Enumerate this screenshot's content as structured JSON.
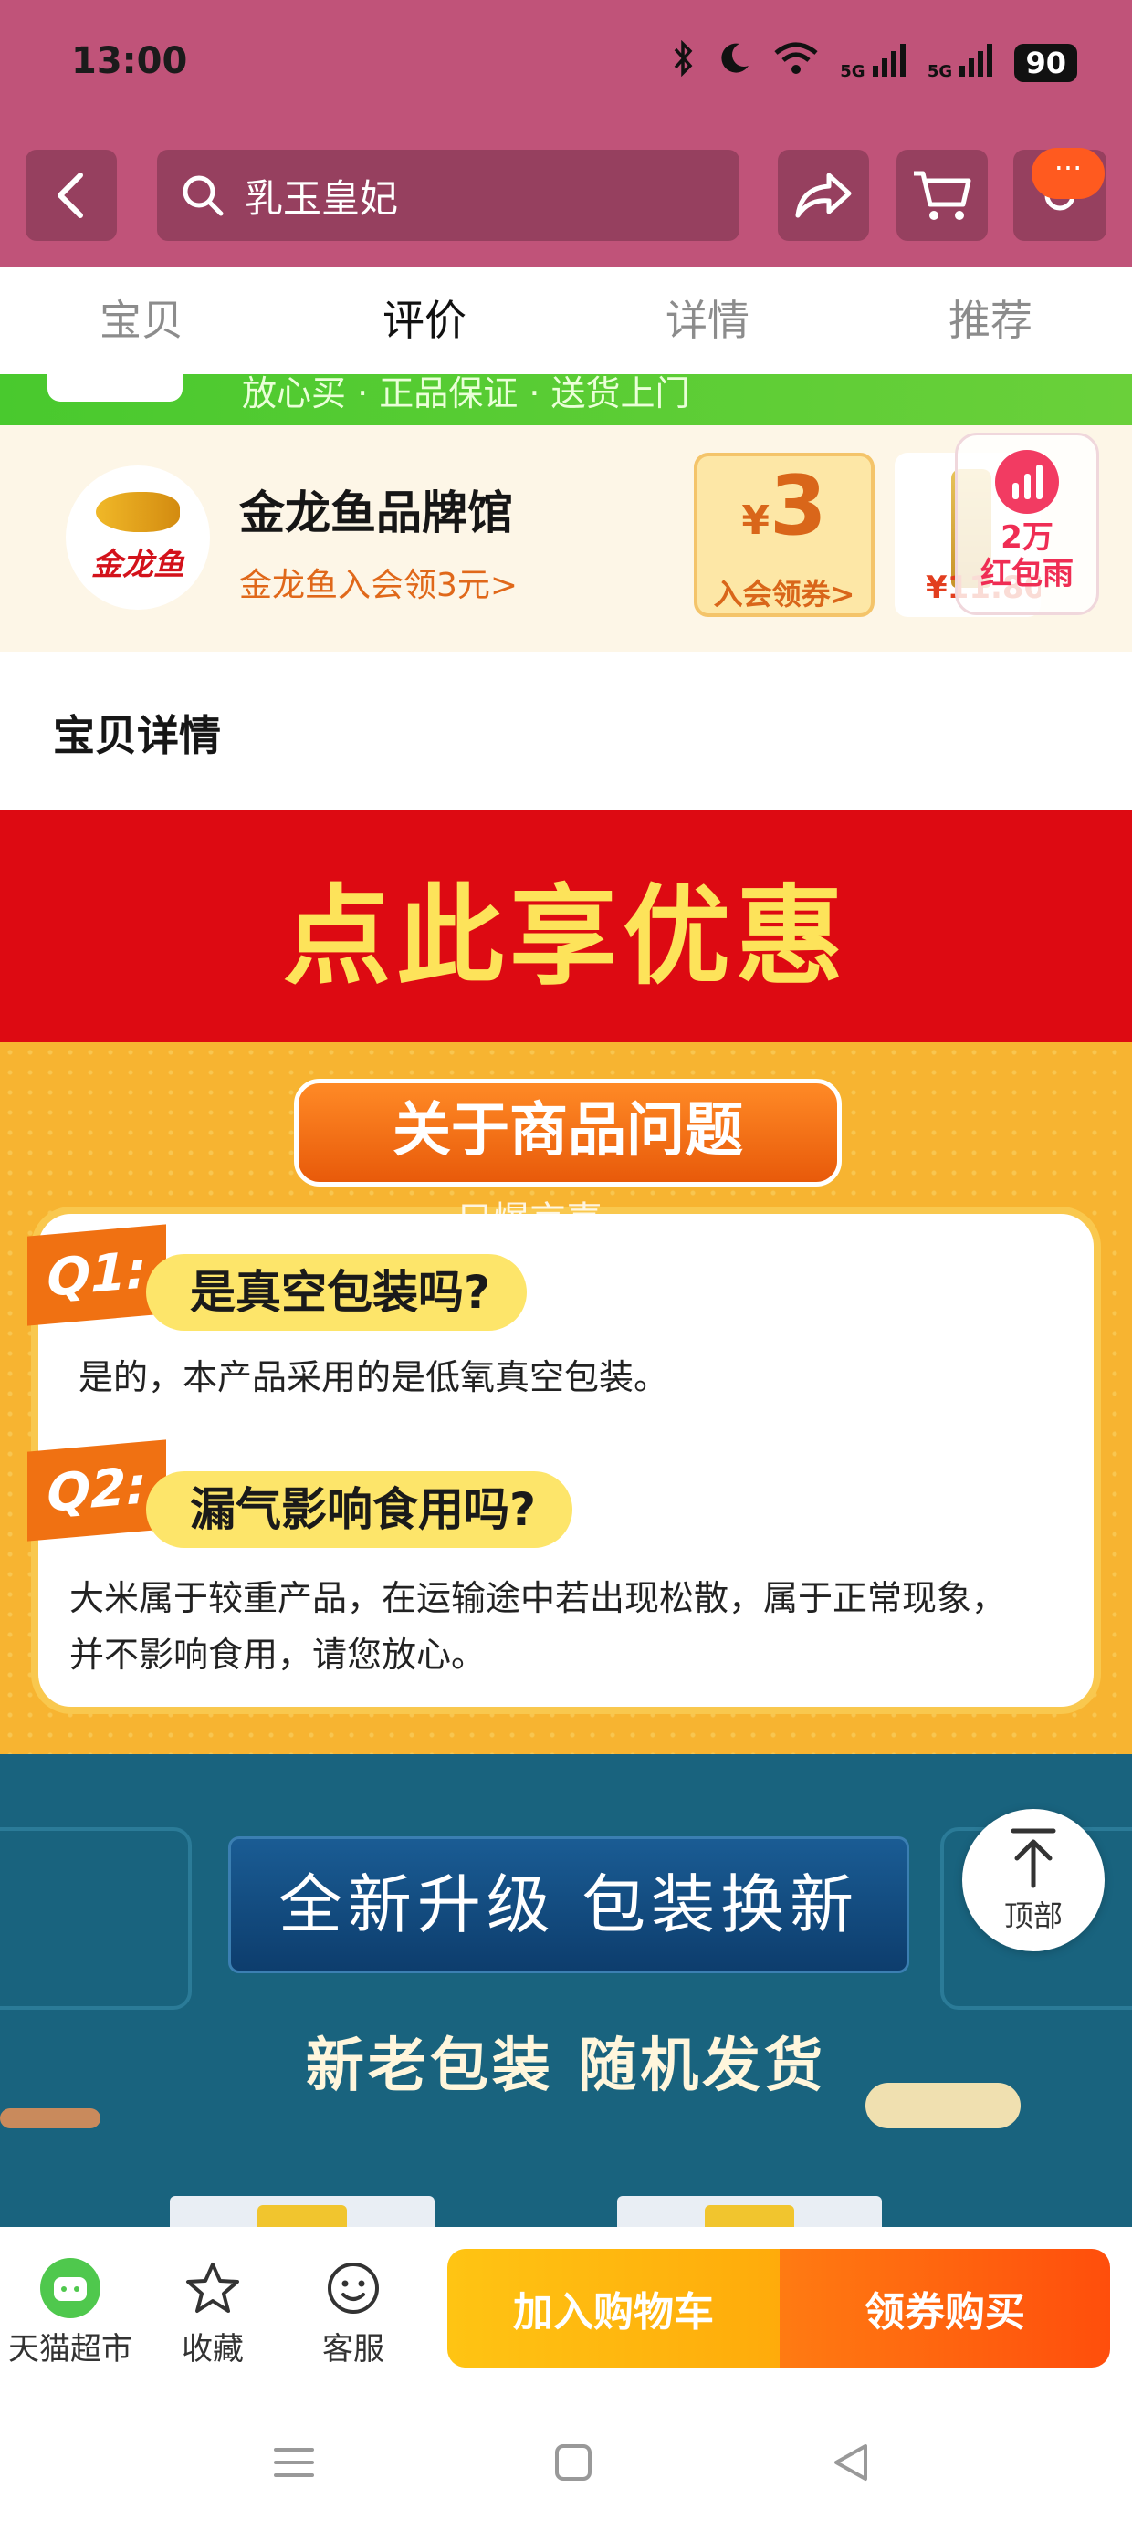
{
  "status_bar": {
    "time": "13:00",
    "bluetooth": "bluetooth-icon",
    "moon": "moon-icon",
    "wifi": "wifi-icon",
    "signal1": "5G",
    "signal2": "5G",
    "battery": "90"
  },
  "header": {
    "search_query": "乳玉皇妃",
    "more_badge": "···"
  },
  "tabs": [
    {
      "label": "宝贝",
      "active": false
    },
    {
      "label": "评价",
      "active": true
    },
    {
      "label": "详情",
      "active": false
    },
    {
      "label": "推荐",
      "active": false
    }
  ],
  "strip": {
    "text": "放心买 · 正品保证 · 送货上门"
  },
  "brand": {
    "logo_text": "金龙鱼",
    "name": "金龙鱼品牌馆",
    "subtitle": "金龙鱼入会领3元>",
    "coupon_symbol": "¥",
    "coupon_amount": "3",
    "coupon_label": "入会领券>",
    "product_price": "¥11.80"
  },
  "red_envelope_widget": {
    "amount": "2万",
    "label": "红包雨"
  },
  "section_title": "宝贝详情",
  "promo_banner": "点此享优惠",
  "faq": {
    "heading": "关于商品问题",
    "watermark": "只爆京喜",
    "items": [
      {
        "tag": "Q1:",
        "question": "是真空包装吗?",
        "answer": "是的，本产品采用的是低氧真空包装。"
      },
      {
        "tag": "Q2:",
        "question": "漏气影响食用吗?",
        "answer_line1": "大米属于较重产品，在运输途中若出现松散，属于正常现象，",
        "answer_line2": "并不影响食用，请您放心。"
      }
    ]
  },
  "upgrade": {
    "banner": "全新升级 包装换新",
    "subline": "新老包装 随机发货"
  },
  "back_to_top": "顶部",
  "bottom_bar": {
    "tmall": "天猫超市",
    "favorite": "收藏",
    "service": "客服",
    "add_to_cart": "加入购物车",
    "buy": "领券购买"
  },
  "colors": {
    "header": "#c05379",
    "accent_orange": "#ff5a1f",
    "cta_yellow": "#ffc413",
    "cta_orange": "#ff4e0c",
    "promo_red": "#dd0a12"
  }
}
